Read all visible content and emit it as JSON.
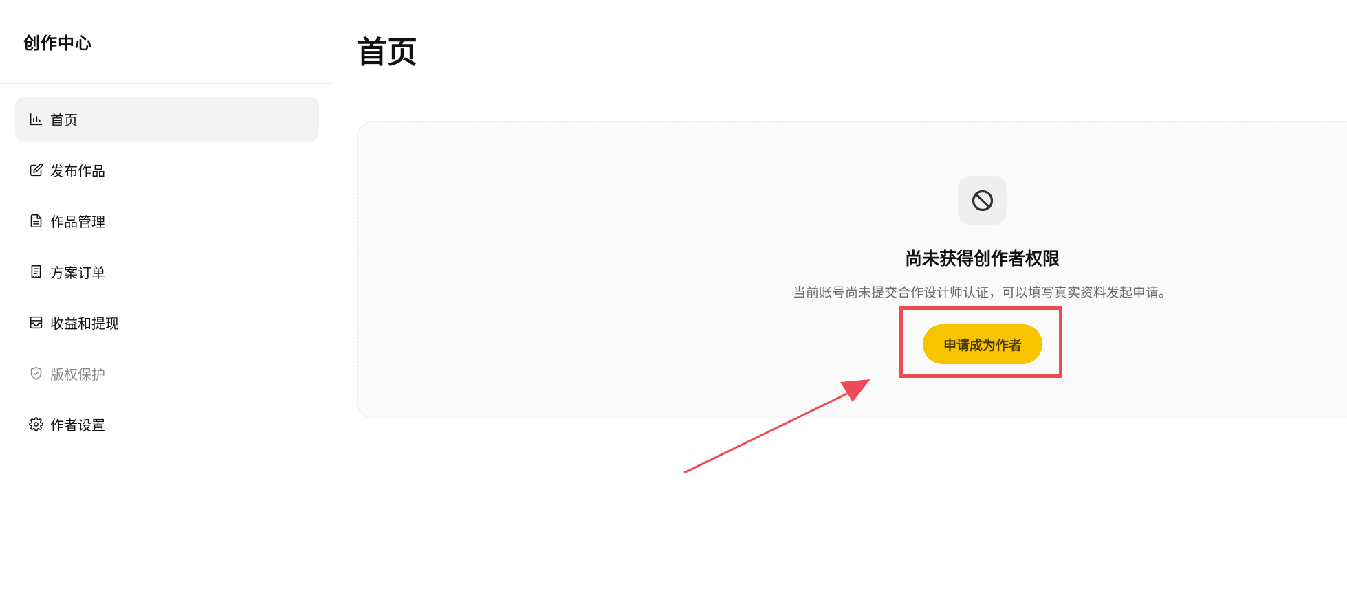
{
  "sidebar": {
    "title": "创作中心",
    "items": [
      {
        "label": "首页",
        "icon": "bar-chart-icon",
        "active": true
      },
      {
        "label": "发布作品",
        "icon": "edit-icon"
      },
      {
        "label": "作品管理",
        "icon": "document-icon"
      },
      {
        "label": "方案订单",
        "icon": "receipt-icon"
      },
      {
        "label": "收益和提现",
        "icon": "wallet-icon"
      },
      {
        "label": "版权保护",
        "icon": "shield-check-icon",
        "disabled": true
      },
      {
        "label": "作者设置",
        "icon": "gear-icon"
      }
    ]
  },
  "main": {
    "title": "首页",
    "empty_state": {
      "icon": "ban-icon",
      "title": "尚未获得创作者权限",
      "description": "当前账号尚未提交合作设计师认证，可以填写真实资料发起申请。",
      "button_label": "申请成为作者"
    }
  },
  "colors": {
    "accent": "#f8c400",
    "annotation": "#ee4b57",
    "active_bg": "#f3f3f3"
  }
}
